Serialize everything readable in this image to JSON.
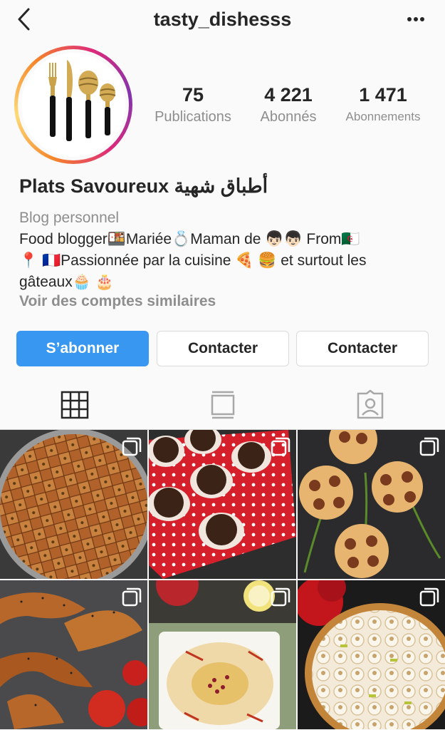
{
  "header": {
    "username": "tasty_dishesss",
    "back_icon": "chevron-left-icon",
    "more_icon": "more-dots-icon"
  },
  "profile": {
    "name": "Plats Savoureux أطباق شهية",
    "category": "Blog personnel",
    "bio_lines": [
      "Food blogger🍱Mariée💍Maman de 👦🏻👦🏻 From🇩🇿",
      "📍 🇫🇷Passionnée par la cuisine 🍕 🍔 et surtout les",
      "gâteaux🧁 🎂"
    ],
    "similar_accounts": "Voir des comptes similaires"
  },
  "stats": {
    "posts": {
      "value": "75",
      "label": "Publications"
    },
    "followers": {
      "value": "4 221",
      "label": "Abonnés"
    },
    "following": {
      "value": "1 471",
      "label": "Abonnements"
    }
  },
  "actions": {
    "follow": "S’abonner",
    "contact_1": "Contacter",
    "contact_2": "Contacter"
  },
  "tabs": [
    {
      "icon": "grid-icon",
      "active": true
    },
    {
      "icon": "feed-icon",
      "active": false
    },
    {
      "icon": "tagged-icon",
      "active": false
    }
  ],
  "posts": [
    {
      "subject": "baklava",
      "multiple": true
    },
    {
      "subject": "chocolate-truffles",
      "multiple": true
    },
    {
      "subject": "flower-sausage-rolls",
      "multiple": true
    },
    {
      "subject": "seeded-croissants",
      "multiple": true
    },
    {
      "subject": "hummus",
      "multiple": true
    },
    {
      "subject": "lemon-meringue-tart",
      "multiple": true
    }
  ],
  "colors": {
    "accent": "#3897f0",
    "text": "#262626",
    "secondary": "#8e8e8e",
    "border": "#dbdbdb",
    "background": "#fafafa"
  }
}
